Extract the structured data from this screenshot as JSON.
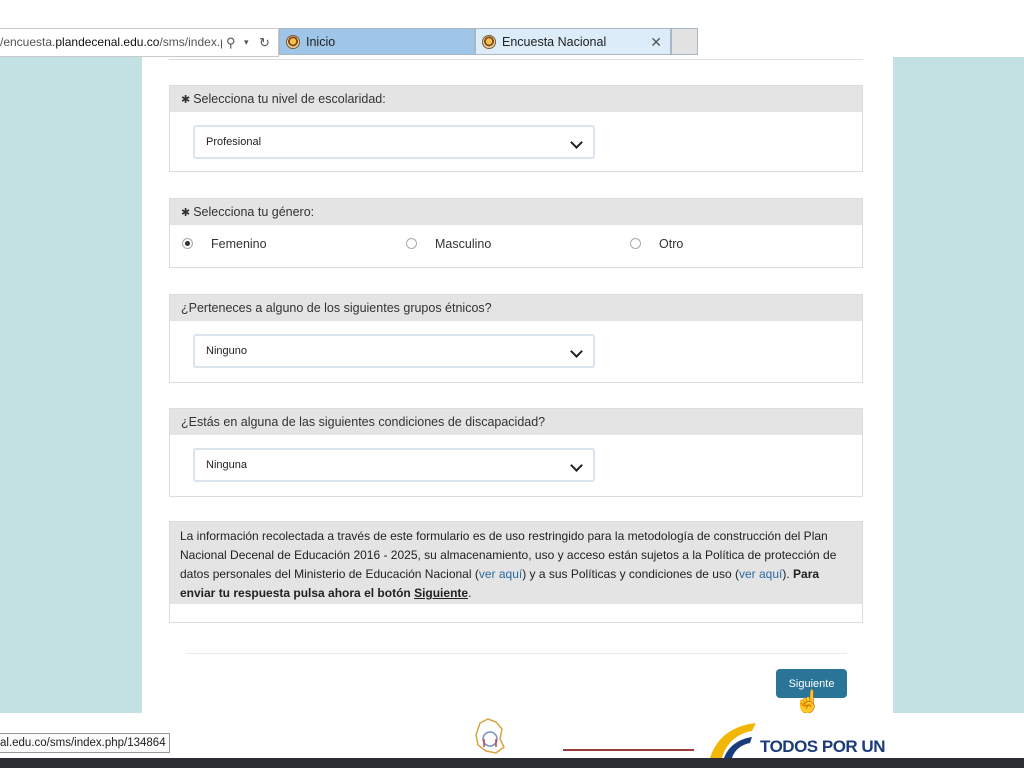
{
  "browser": {
    "url_prefix": "/encuesta.",
    "url_domain": "plandecenal.edu.co",
    "url_suffix": "/sms/index.p",
    "tabs": [
      {
        "label": "Inicio"
      },
      {
        "label": "Encuesta Nacional"
      }
    ]
  },
  "form": {
    "education": {
      "required_mark": "✱",
      "question": "Selecciona tu nivel de escolaridad:",
      "selected": "Profesional"
    },
    "gender": {
      "required_mark": "✱",
      "question": "Selecciona tu género:",
      "options": [
        "Femenino",
        "Masculino",
        "Otro"
      ],
      "selected_index": 0
    },
    "ethnic": {
      "question": "¿Perteneces a alguno de los siguientes grupos étnicos?",
      "selected": "Ninguno"
    },
    "disability": {
      "question": "¿Estás en alguna de las siguientes condiciones de discapacidad?",
      "selected": "Ninguna"
    },
    "privacy": {
      "text_1": "La información recolectada a través de este formulario es de uso restringido para la metodología de construcción del Plan Nacional Decenal de Educación 2016 - 2025, su almacenamiento, uso y acceso están sujetos a la Política de protección de datos personales del Ministerio de Educación Nacional (",
      "link_1": "ver aquí",
      "text_2": ") y a sus Políticas y condiciones de uso (",
      "link_2": "ver aquí",
      "text_3": "). ",
      "bold_text": "Para enviar tu respuesta pulsa ahora el botón ",
      "bold_underline": "Siguiente",
      "end": "."
    },
    "next_button": "Siguiente"
  },
  "status_bar": {
    "url": "al.edu.co/sms/index.php/134864"
  },
  "footer": {
    "brand_text": "TODOS POR UN"
  },
  "colors": {
    "side_background": "#c3e1e3",
    "panel_header": "#e4e4e4",
    "button": "#2a7498",
    "link": "#2a6aa0"
  }
}
